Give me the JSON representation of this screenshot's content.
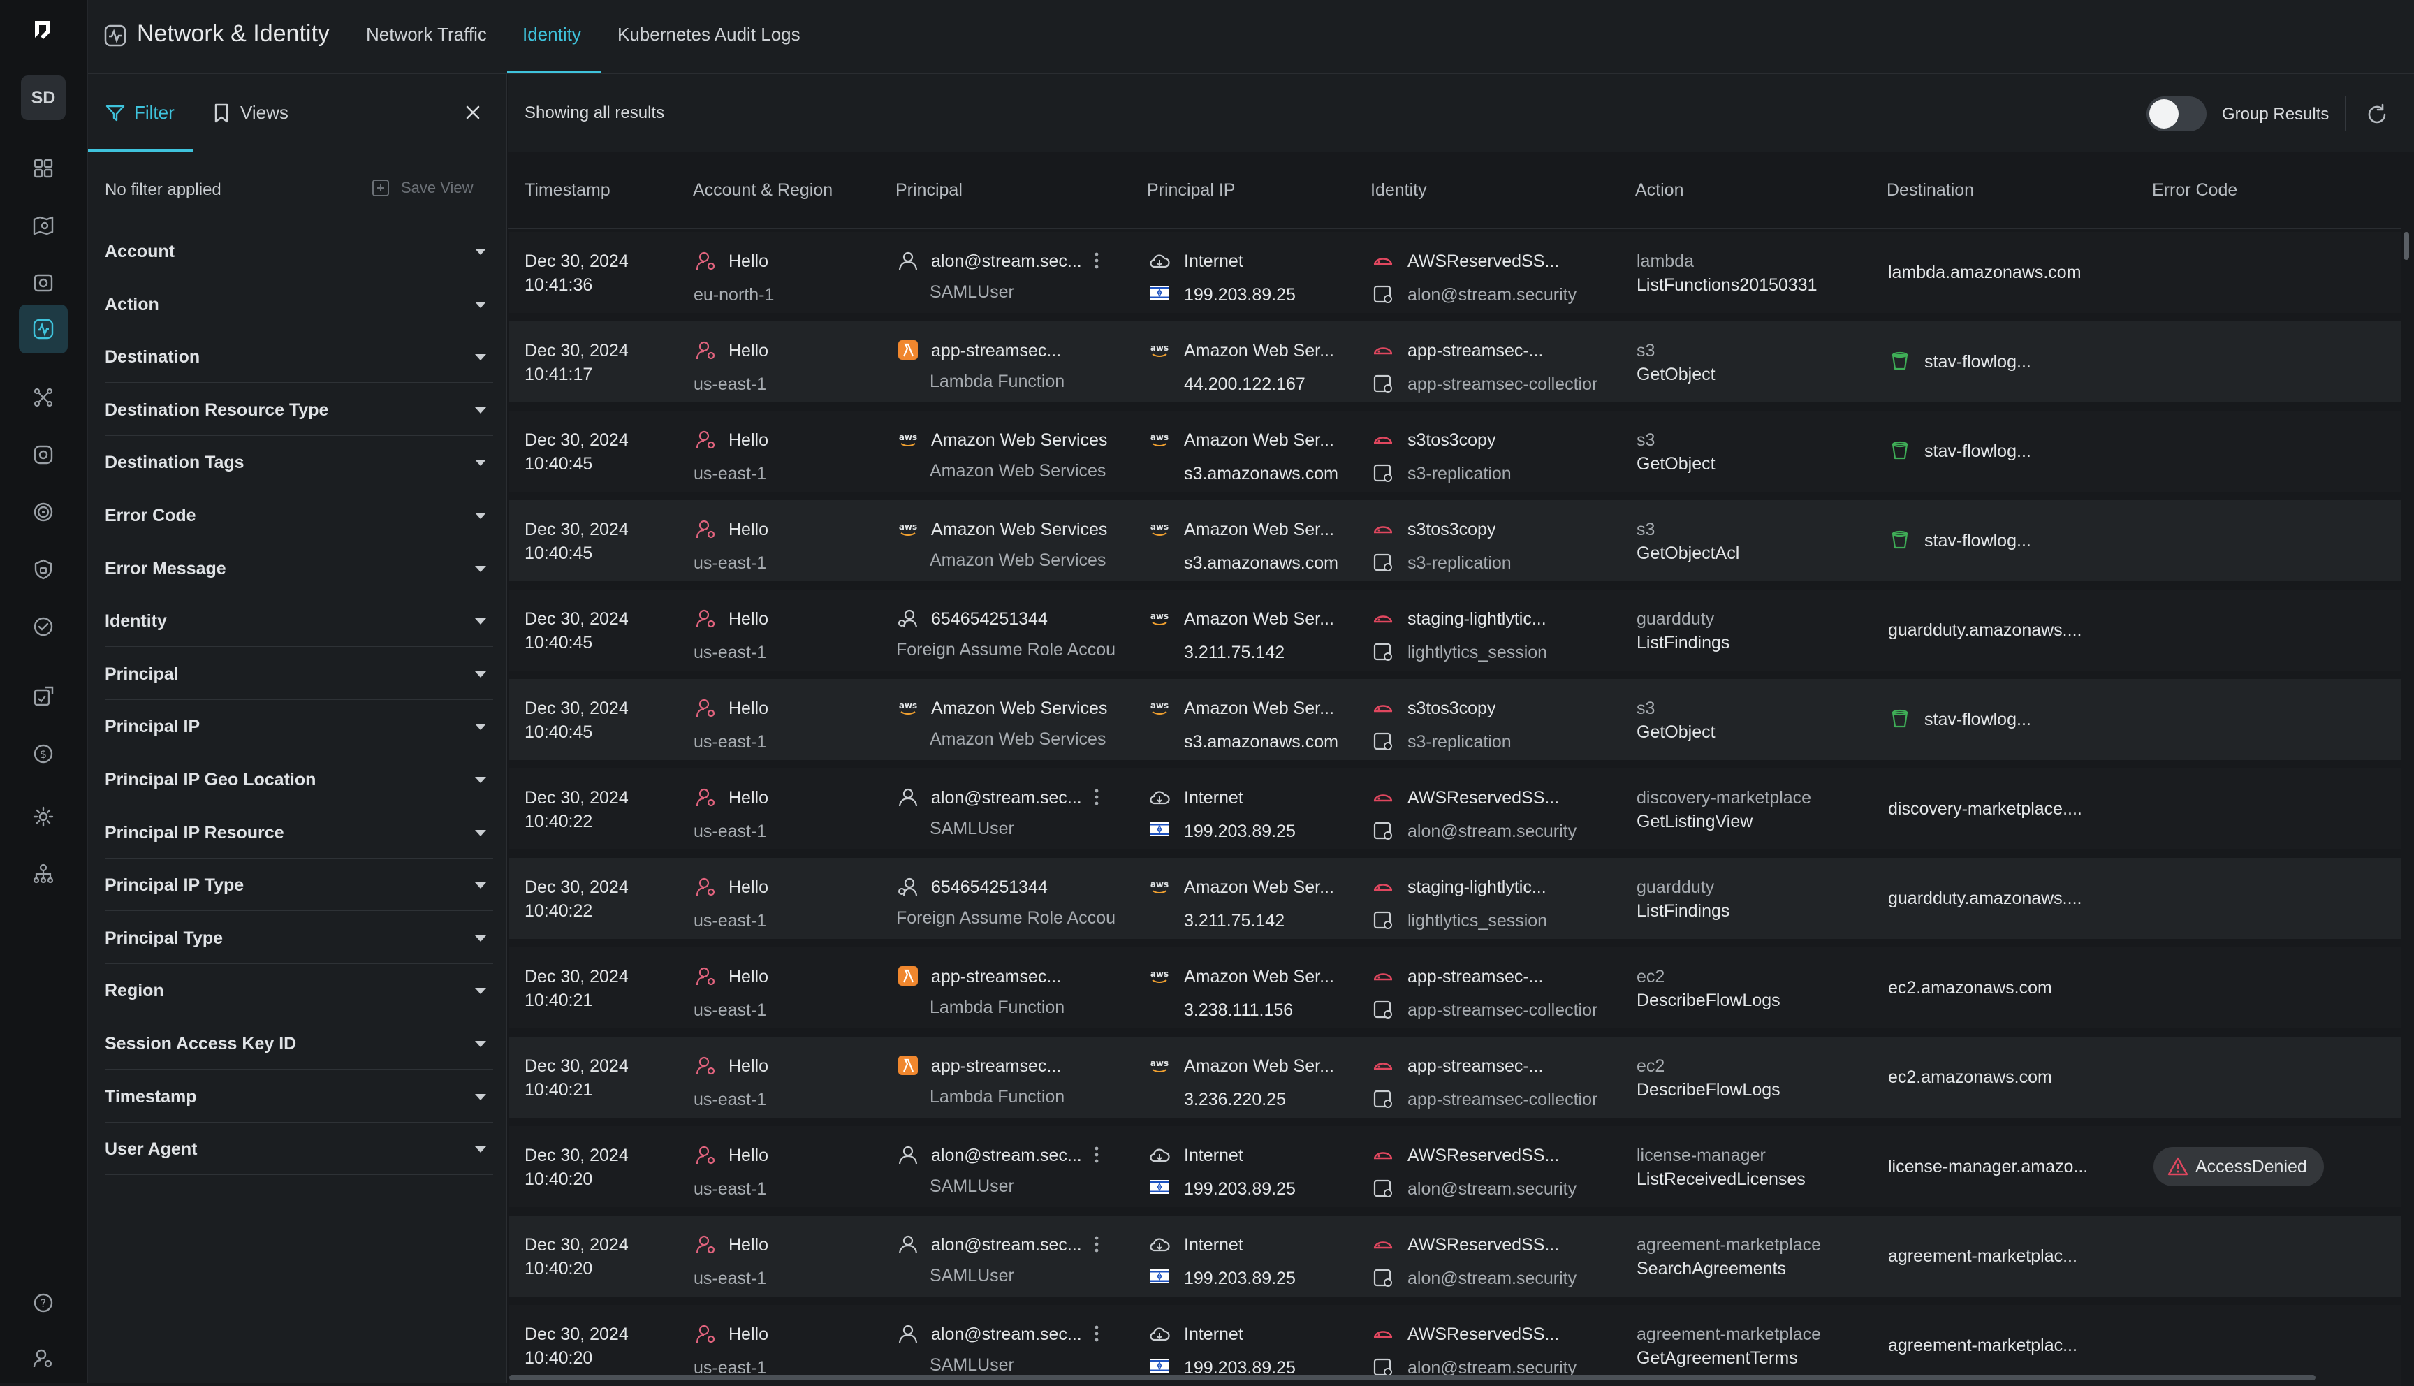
{
  "rail": {
    "avatar": "SD",
    "nav_icons": [
      "dashboard-icon",
      "map-search-icon",
      "inventory-icon",
      "network-activity-icon",
      "graph-icon",
      "bug-icon",
      "target-icon",
      "shield-icon",
      "compliance-check-icon",
      "policy-icon",
      "cost-icon",
      "settings-icon",
      "org-tree-icon"
    ],
    "bottom_icons": [
      "help-icon",
      "user-settings-icon"
    ]
  },
  "header": {
    "title": "Network & Identity",
    "tabs": [
      {
        "label": "Network Traffic",
        "active": false
      },
      {
        "label": "Identity",
        "active": true
      },
      {
        "label": "Kubernetes Audit Logs",
        "active": false
      }
    ]
  },
  "filter_panel": {
    "tab_filter": "Filter",
    "tab_views": "Views",
    "status": "No filter applied",
    "save_view": "Save View",
    "items": [
      "Account",
      "Action",
      "Destination",
      "Destination Resource Type",
      "Destination Tags",
      "Error Code",
      "Error Message",
      "Identity",
      "Principal",
      "Principal IP",
      "Principal IP Geo Location",
      "Principal IP Resource",
      "Principal IP Type",
      "Principal Type",
      "Region",
      "Session Access Key ID",
      "Timestamp",
      "User Agent"
    ]
  },
  "results": {
    "status": "Showing all results",
    "group_label": "Group Results",
    "group_enabled": false,
    "columns": [
      "Timestamp",
      "Account & Region",
      "Principal",
      "Principal IP",
      "Identity",
      "Action",
      "Destination",
      "Error Code"
    ],
    "rows": [
      {
        "date": "Dec 30, 2024",
        "time": "10:41:36",
        "account": "Hello",
        "region": "eu-north-1",
        "principal_icon": "user-icon",
        "principal": "alon@stream.sec...",
        "principal_type": "SAMLUser",
        "principal_menu": true,
        "ip_icon": "cloud-icon",
        "ip_name": "Internet",
        "ip_flag": true,
        "ip_addr": "199.203.89.25",
        "identity": "AWSReservedSS...",
        "identity_sub": "alon@stream.security",
        "action_service": "lambda",
        "action_name": "ListFunctions20150331",
        "dest_icon": "",
        "destination": "lambda.amazonaws.com",
        "error": ""
      },
      {
        "date": "Dec 30, 2024",
        "time": "10:41:17",
        "account": "Hello",
        "region": "us-east-1",
        "principal_icon": "lambda-icon",
        "principal": "app-streamsec...",
        "principal_type": "Lambda Function",
        "principal_menu": false,
        "ip_icon": "aws-icon",
        "ip_name": "Amazon Web Ser...",
        "ip_flag": false,
        "ip_addr": "44.200.122.167",
        "identity": "app-streamsec-...",
        "identity_sub": "app-streamsec-collectior",
        "action_service": "s3",
        "action_name": "GetObject",
        "dest_icon": "bucket-icon",
        "destination": "stav-flowlog...",
        "error": ""
      },
      {
        "date": "Dec 30, 2024",
        "time": "10:40:45",
        "account": "Hello",
        "region": "us-east-1",
        "principal_icon": "aws-icon",
        "principal": "Amazon Web Services",
        "principal_type": "Amazon Web Services",
        "principal_menu": false,
        "ip_icon": "aws-icon",
        "ip_name": "Amazon Web Ser...",
        "ip_flag": false,
        "ip_addr": "s3.amazonaws.com",
        "identity": "s3tos3copy",
        "identity_sub": "s3-replication",
        "action_service": "s3",
        "action_name": "GetObject",
        "dest_icon": "bucket-icon",
        "destination": "stav-flowlog...",
        "error": ""
      },
      {
        "date": "Dec 30, 2024",
        "time": "10:40:45",
        "account": "Hello",
        "region": "us-east-1",
        "principal_icon": "aws-icon",
        "principal": "Amazon Web Services",
        "principal_type": "Amazon Web Services",
        "principal_menu": false,
        "ip_icon": "aws-icon",
        "ip_name": "Amazon Web Ser...",
        "ip_flag": false,
        "ip_addr": "s3.amazonaws.com",
        "identity": "s3tos3copy",
        "identity_sub": "s3-replication",
        "action_service": "s3",
        "action_name": "GetObjectAcl",
        "dest_icon": "bucket-icon",
        "destination": "stav-flowlog...",
        "error": ""
      },
      {
        "date": "Dec 30, 2024",
        "time": "10:40:45",
        "account": "Hello",
        "region": "us-east-1",
        "principal_icon": "assume-role-icon",
        "principal": "654654251344",
        "principal_type": "Foreign Assume Role Accou",
        "principal_menu": false,
        "ip_icon": "aws-icon",
        "ip_name": "Amazon Web Ser...",
        "ip_flag": false,
        "ip_addr": "3.211.75.142",
        "identity": "staging-lightlytic...",
        "identity_sub": "lightlytics_session",
        "action_service": "guardduty",
        "action_name": "ListFindings",
        "dest_icon": "",
        "destination": "guardduty.amazonaws....",
        "error": ""
      },
      {
        "date": "Dec 30, 2024",
        "time": "10:40:45",
        "account": "Hello",
        "region": "us-east-1",
        "principal_icon": "aws-icon",
        "principal": "Amazon Web Services",
        "principal_type": "Amazon Web Services",
        "principal_menu": false,
        "ip_icon": "aws-icon",
        "ip_name": "Amazon Web Ser...",
        "ip_flag": false,
        "ip_addr": "s3.amazonaws.com",
        "identity": "s3tos3copy",
        "identity_sub": "s3-replication",
        "action_service": "s3",
        "action_name": "GetObject",
        "dest_icon": "bucket-icon",
        "destination": "stav-flowlog...",
        "error": ""
      },
      {
        "date": "Dec 30, 2024",
        "time": "10:40:22",
        "account": "Hello",
        "region": "us-east-1",
        "principal_icon": "user-icon",
        "principal": "alon@stream.sec...",
        "principal_type": "SAMLUser",
        "principal_menu": true,
        "ip_icon": "cloud-icon",
        "ip_name": "Internet",
        "ip_flag": true,
        "ip_addr": "199.203.89.25",
        "identity": "AWSReservedSS...",
        "identity_sub": "alon@stream.security",
        "action_service": "discovery-marketplace",
        "action_name": "GetListingView",
        "dest_icon": "",
        "destination": "discovery-marketplace....",
        "error": ""
      },
      {
        "date": "Dec 30, 2024",
        "time": "10:40:22",
        "account": "Hello",
        "region": "us-east-1",
        "principal_icon": "assume-role-icon",
        "principal": "654654251344",
        "principal_type": "Foreign Assume Role Accou",
        "principal_menu": false,
        "ip_icon": "aws-icon",
        "ip_name": "Amazon Web Ser...",
        "ip_flag": false,
        "ip_addr": "3.211.75.142",
        "identity": "staging-lightlytic...",
        "identity_sub": "lightlytics_session",
        "action_service": "guardduty",
        "action_name": "ListFindings",
        "dest_icon": "",
        "destination": "guardduty.amazonaws....",
        "error": ""
      },
      {
        "date": "Dec 30, 2024",
        "time": "10:40:21",
        "account": "Hello",
        "region": "us-east-1",
        "principal_icon": "lambda-icon",
        "principal": "app-streamsec...",
        "principal_type": "Lambda Function",
        "principal_menu": false,
        "ip_icon": "aws-icon",
        "ip_name": "Amazon Web Ser...",
        "ip_flag": false,
        "ip_addr": "3.238.111.156",
        "identity": "app-streamsec-...",
        "identity_sub": "app-streamsec-collectior",
        "action_service": "ec2",
        "action_name": "DescribeFlowLogs",
        "dest_icon": "",
        "destination": "ec2.amazonaws.com",
        "error": ""
      },
      {
        "date": "Dec 30, 2024",
        "time": "10:40:21",
        "account": "Hello",
        "region": "us-east-1",
        "principal_icon": "lambda-icon",
        "principal": "app-streamsec...",
        "principal_type": "Lambda Function",
        "principal_menu": false,
        "ip_icon": "aws-icon",
        "ip_name": "Amazon Web Ser...",
        "ip_flag": false,
        "ip_addr": "3.236.220.25",
        "identity": "app-streamsec-...",
        "identity_sub": "app-streamsec-collectior",
        "action_service": "ec2",
        "action_name": "DescribeFlowLogs",
        "dest_icon": "",
        "destination": "ec2.amazonaws.com",
        "error": ""
      },
      {
        "date": "Dec 30, 2024",
        "time": "10:40:20",
        "account": "Hello",
        "region": "us-east-1",
        "principal_icon": "user-icon",
        "principal": "alon@stream.sec...",
        "principal_type": "SAMLUser",
        "principal_menu": true,
        "ip_icon": "cloud-icon",
        "ip_name": "Internet",
        "ip_flag": true,
        "ip_addr": "199.203.89.25",
        "identity": "AWSReservedSS...",
        "identity_sub": "alon@stream.security",
        "action_service": "license-manager",
        "action_name": "ListReceivedLicenses",
        "dest_icon": "",
        "destination": "license-manager.amazo...",
        "error": "AccessDenied"
      },
      {
        "date": "Dec 30, 2024",
        "time": "10:40:20",
        "account": "Hello",
        "region": "us-east-1",
        "principal_icon": "user-icon",
        "principal": "alon@stream.sec...",
        "principal_type": "SAMLUser",
        "principal_menu": true,
        "ip_icon": "cloud-icon",
        "ip_name": "Internet",
        "ip_flag": true,
        "ip_addr": "199.203.89.25",
        "identity": "AWSReservedSS...",
        "identity_sub": "alon@stream.security",
        "action_service": "agreement-marketplace",
        "action_name": "SearchAgreements",
        "dest_icon": "",
        "destination": "agreement-marketplac...",
        "error": ""
      },
      {
        "date": "Dec 30, 2024",
        "time": "10:40:20",
        "account": "Hello",
        "region": "us-east-1",
        "principal_icon": "user-icon",
        "principal": "alon@stream.sec...",
        "principal_type": "SAMLUser",
        "principal_menu": true,
        "ip_icon": "cloud-icon",
        "ip_name": "Internet",
        "ip_flag": true,
        "ip_addr": "199.203.89.25",
        "identity": "AWSReservedSS...",
        "identity_sub": "alon@stream.security",
        "action_service": "agreement-marketplace",
        "action_name": "GetAgreementTerms",
        "dest_icon": "",
        "destination": "agreement-marketplac...",
        "error": ""
      }
    ]
  },
  "colors": {
    "accent": "#3fc3dc",
    "account_icon": "#e0637d",
    "identity_icon": "#e0475f",
    "lambda": "#f0872e",
    "bucket": "#3fae57",
    "error": "#e0475f"
  }
}
